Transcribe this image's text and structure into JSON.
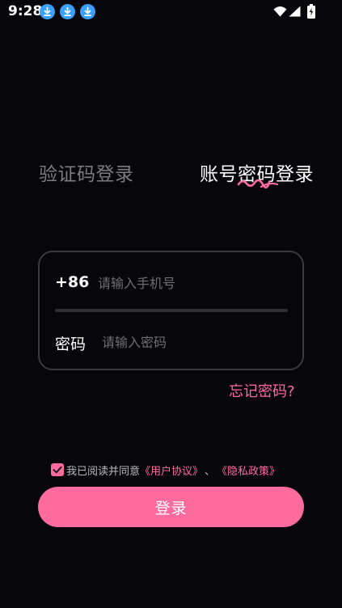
{
  "status_bar": {
    "time": "9:28",
    "notification_icons": [
      "download-icon",
      "download-icon",
      "download-icon"
    ],
    "system_icons": [
      "wifi-icon",
      "signal-icon",
      "battery-icon"
    ]
  },
  "tabs": [
    {
      "label": "验证码登录",
      "active": false
    },
    {
      "label": "账号密码登录",
      "active": true
    }
  ],
  "form": {
    "phone_prefix": "+86",
    "phone_placeholder": "请输入手机号",
    "password_label": "密码",
    "password_placeholder": "请输入密码"
  },
  "forgot_password": "忘记密码?",
  "agreement": {
    "checked": true,
    "text": "我已阅读并同意",
    "user_agreement": "《用户协议》",
    "separator": "、",
    "privacy_policy": "《隐私政策》"
  },
  "login_button": "登录",
  "colors": {
    "background": "#07060b",
    "accent": "#ff6b9d",
    "inactive_tab": "#7c7b81",
    "card_border": "#3b3a40",
    "download_icon": "#3aa0ff"
  }
}
